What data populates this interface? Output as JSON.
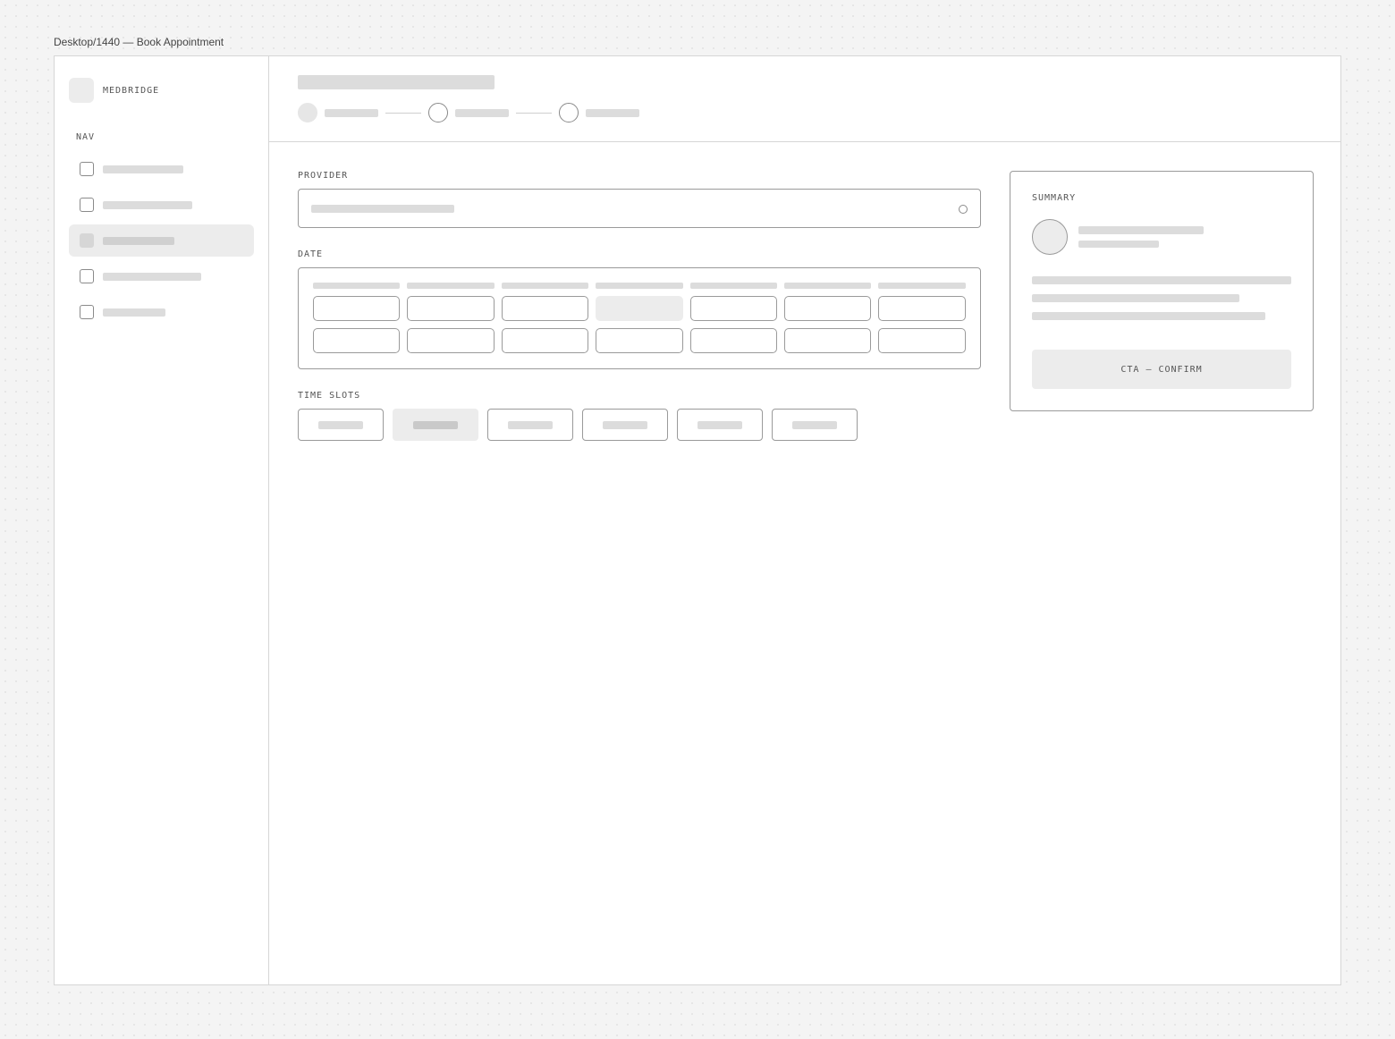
{
  "frame_label": "Desktop/1440 — Book Appointment",
  "sidebar": {
    "brand": "MEDBRIDGE",
    "nav_label": "NAV",
    "items": [
      {
        "active": false
      },
      {
        "active": false
      },
      {
        "active": true
      },
      {
        "active": false
      },
      {
        "active": false
      }
    ]
  },
  "header": {
    "steps": [
      {
        "state": "done"
      },
      {
        "state": "pending"
      },
      {
        "state": "pending"
      }
    ]
  },
  "form": {
    "provider_label": "PROVIDER",
    "date_label": "DATE",
    "calendar": {
      "columns": 7,
      "rows": 2,
      "selected_day": {
        "row": 0,
        "col": 3
      }
    },
    "time_slots_label": "TIME SLOTS",
    "time_slots": [
      {
        "selected": false
      },
      {
        "selected": true
      },
      {
        "selected": false
      },
      {
        "selected": false
      },
      {
        "selected": false
      },
      {
        "selected": false
      }
    ]
  },
  "summary": {
    "label": "SUMMARY",
    "cta_label": "CTA — CONFIRM"
  },
  "colors": {
    "border": "#9a9a9a",
    "placeholder": "#dcdcdc",
    "selected_fill": "#ececec",
    "canvas": "#f4f4f4"
  }
}
